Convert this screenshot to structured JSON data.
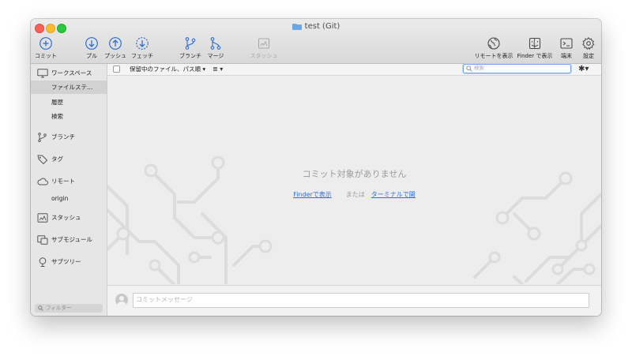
{
  "window": {
    "title": "test (Git)"
  },
  "toolbar": {
    "commit": "コミット",
    "pull": "プル",
    "push": "プッシュ",
    "fetch": "フェッチ",
    "branch": "ブランチ",
    "merge": "マージ",
    "stash": "スタッシュ",
    "show_remote": "リモートを表示",
    "show_in_finder": "Finder で表示",
    "terminal": "端末",
    "settings": "設定"
  },
  "filterbar": {
    "file_filter": "保留中のファイル、パス順 ▾",
    "view_mode": "≣ ▾",
    "search_placeholder": "検索",
    "gear_menu": "✱▾"
  },
  "sidebar": {
    "workspace": "ワークスペース",
    "workspace_items": [
      "ファイルステ…",
      "履歴",
      "検索"
    ],
    "branches": "ブランチ",
    "tags": "タグ",
    "remotes": "リモート",
    "remote_items": [
      "origin"
    ],
    "stashes": "スタッシュ",
    "submodules": "サブモジュール",
    "subtrees": "サブツリー",
    "filter_placeholder": "フィルター"
  },
  "main": {
    "empty_message": "コミット対象がありません",
    "show_in_finder_link": "Finderで表示",
    "or_text": "または",
    "open_terminal_link": "ターミナルで開"
  },
  "commit": {
    "message_placeholder": "コミットメッセージ"
  },
  "colors": {
    "accent": "#2e6fd6",
    "toolbar_icon": "#2f6ccf",
    "search_focus": "#6fa6ef"
  },
  "icons": [
    "plus-circle-icon",
    "arrow-down-circle-icon",
    "arrow-up-circle-icon",
    "dashed-arrow-down-circle-icon",
    "branch-icon",
    "merge-icon",
    "stash-icon",
    "globe-icon",
    "finder-icon",
    "terminal-icon",
    "gear-icon",
    "monitor-icon",
    "tag-icon",
    "cloud-icon",
    "submodule-icon",
    "subtree-icon",
    "search-icon",
    "avatar-icon",
    "folder-icon"
  ]
}
